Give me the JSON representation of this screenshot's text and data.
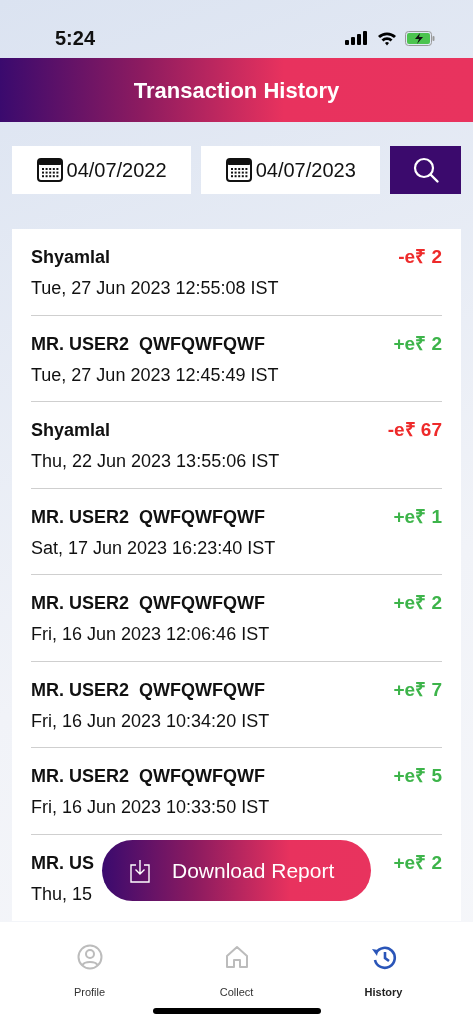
{
  "status_bar": {
    "time": "5:24"
  },
  "header": {
    "title": "Transaction History"
  },
  "filters": {
    "from_date": "04/07/2022",
    "to_date": "04/07/2023"
  },
  "transactions": [
    {
      "name": "Shyamlal",
      "date": "Tue, 27 Jun 2023 12:55:08 IST",
      "amount": "-e₹ 2",
      "kind": "debit"
    },
    {
      "name": "MR. USER2  QWFQWFQWF",
      "date": "Tue, 27 Jun 2023 12:45:49 IST",
      "amount": "+e₹ 2",
      "kind": "credit"
    },
    {
      "name": "Shyamlal",
      "date": "Thu, 22 Jun 2023 13:55:06 IST",
      "amount": "-e₹ 67",
      "kind": "debit"
    },
    {
      "name": "MR. USER2  QWFQWFQWF",
      "date": "Sat, 17 Jun 2023 16:23:40 IST",
      "amount": "+e₹ 1",
      "kind": "credit"
    },
    {
      "name": "MR. USER2  QWFQWFQWF",
      "date": "Fri, 16 Jun 2023 12:06:46 IST",
      "amount": "+e₹ 2",
      "kind": "credit"
    },
    {
      "name": "MR. USER2  QWFQWFQWF",
      "date": "Fri, 16 Jun 2023 10:34:20 IST",
      "amount": "+e₹ 7",
      "kind": "credit"
    },
    {
      "name": "MR. USER2  QWFQWFQWF",
      "date": "Fri, 16 Jun 2023 10:33:50 IST",
      "amount": "+e₹ 5",
      "kind": "credit"
    },
    {
      "name": "MR. US",
      "date": "Thu, 15",
      "amount": "+e₹ 2",
      "kind": "credit"
    }
  ],
  "download_button": {
    "label": "Download Report"
  },
  "tab_bar": [
    {
      "label": "Profile",
      "selected": false
    },
    {
      "label": "Collect",
      "selected": false
    },
    {
      "label": "History",
      "selected": true
    }
  ]
}
